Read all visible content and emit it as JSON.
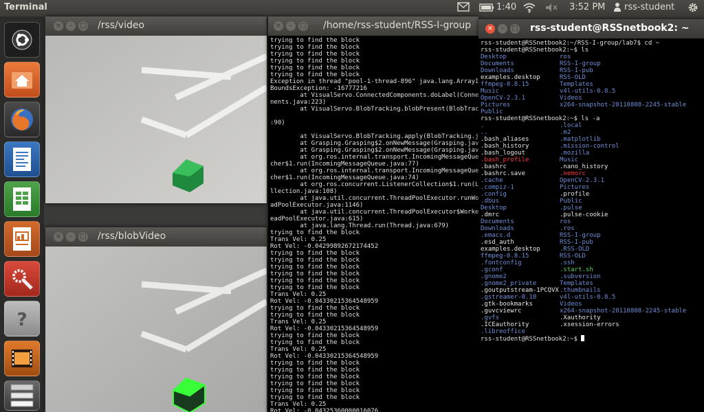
{
  "topbar": {
    "app_title": "Terminal",
    "clock_main": "1:40",
    "clock_time": "3:52 PM",
    "user": "rss-student"
  },
  "launcher": {
    "items": [
      {
        "name": "dash-home-icon"
      },
      {
        "name": "home-folder-icon"
      },
      {
        "name": "firefox-icon"
      },
      {
        "name": "writer-icon"
      },
      {
        "name": "calc-icon"
      },
      {
        "name": "impress-icon"
      },
      {
        "name": "system-settings-icon"
      },
      {
        "name": "help-icon"
      },
      {
        "name": "video-editor-icon"
      },
      {
        "name": "workspace-switcher-icon"
      }
    ]
  },
  "windows": {
    "video": {
      "title": "/rss/video"
    },
    "blob": {
      "title": "/rss/blobVideo"
    },
    "terminal_main": {
      "title": "/home/rss-student/RSS-I-group"
    },
    "terminal_right": {
      "title": "rss-student@RSSnetbook2: ~"
    }
  },
  "terminal_main_lines": [
    "trying to find the block",
    "trying to find the block",
    "trying to find the block",
    "trying to find the block",
    "trying to find the block",
    "trying to find the block",
    "Exception in thread \"pool-1-thread-896\" java.lang.ArrayIndex",
    "BoundsException: -16777216",
    "        at VisualServo.ConnectedComponents.doLabel(Connecte",
    "nents.java:223)",
    "        at VisualServo.BlobTracking.blobPresent(BlobTracking",
    "",
    ":90)",
    "",
    "        at VisualServo.BlobTracking.apply(BlobTracking.java",
    "        at Grasping.Grasping$2.onNewMessage(Grasping.java:31",
    "        at Grasping.Grasping$2.onNewMessage(Grasping.java:23",
    "        at org.ros.internal.transport.IncomingMessageQueue$1",
    "cher$1.run(IncomingMessageQueue.java:77)",
    "        at org.ros.internal.transport.IncomingMessageQueue$D",
    "cher$1.run(IncomingMessageQueue.java:74)",
    "        at org.ros.concurrent.ListenerCollection$1.run(Liste",
    "llection.java:108)",
    "        at java.util.concurrent.ThreadPoolExecutor.runWorker",
    "adPoolExecutor.java:1146)",
    "        at java.util.concurrent.ThreadPoolExecutor$Worker.ru",
    "eadPoolExecutor.java:615)",
    "        at java.lang.Thread.run(Thread.java:679)",
    "trying to find the block",
    "Trans Vel: 0.25",
    "Rot Vel: -0.04299892672174452",
    "trying to find the block",
    "trying to find the block",
    "trying to find the block",
    "trying to find the block",
    "trying to find the block",
    "trying to find the block",
    "Trans Vel: 0.25",
    "Rot Vel: -0.04330215364548959",
    "trying to find the block",
    "trying to find the block",
    "Trans Vel: 0.25",
    "Rot Vel: -0.04330215364548959",
    "trying to find the block",
    "trying to find the block",
    "Trans Vel: 0.25",
    "Rot Vel: -0.04330215364548959",
    "trying to find the block",
    "trying to find the block",
    "trying to find the block",
    "trying to find the block",
    "trying to find the block",
    "trying to find the block",
    "Trans Vel: 0.25",
    "Rot Vel: -0.04325360000016076"
  ],
  "terminal_right": {
    "cmd1_prompt": "rss-student@RSSnetbook2:~/RSS-I-group/lab7$ cd ~",
    "cmd2_prompt": "rss-student@RSSnetbook2:~$ ls",
    "ls_rows": [
      [
        {
          "t": "Desktop",
          "c": "blue"
        },
        {
          "t": "ros",
          "c": "blue"
        }
      ],
      [
        {
          "t": "Documents",
          "c": "blue"
        },
        {
          "t": "RSS-I-group",
          "c": "blue"
        }
      ],
      [
        {
          "t": "Downloads",
          "c": "blue"
        },
        {
          "t": "RSS-I-pub",
          "c": "blue"
        }
      ],
      [
        {
          "t": "examples.desktop",
          "c": "white"
        },
        {
          "t": "RSS-OLD",
          "c": "blue"
        }
      ],
      [
        {
          "t": "ffmpeg-0.8.15",
          "c": "blue"
        },
        {
          "t": "Templates",
          "c": "blue"
        }
      ],
      [
        {
          "t": "Music",
          "c": "blue"
        },
        {
          "t": "v4l-utils-0.8.5",
          "c": "blue"
        }
      ],
      [
        {
          "t": "OpenCV-2.3.1",
          "c": "blue"
        },
        {
          "t": "Videos",
          "c": "blue"
        }
      ],
      [
        {
          "t": "Pictures",
          "c": "blue"
        },
        {
          "t": "x264-snapshot-20110808-2245-stable",
          "c": "blue"
        }
      ],
      [
        {
          "t": "Public",
          "c": "blue"
        },
        {
          "t": "",
          "c": "white"
        }
      ]
    ],
    "cmd3_prompt": "rss-student@RSSnetbook2:~$ ls -a",
    "lsa_rows": [
      [
        {
          "t": ".",
          "c": "blue"
        },
        {
          "t": ".local",
          "c": "blue"
        }
      ],
      [
        {
          "t": "..",
          "c": "blue"
        },
        {
          "t": ".m2",
          "c": "blue"
        }
      ],
      [
        {
          "t": ".bash_aliases",
          "c": "white"
        },
        {
          "t": ".matplotlib",
          "c": "blue"
        }
      ],
      [
        {
          "t": ".bash_history",
          "c": "white"
        },
        {
          "t": ".mission-control",
          "c": "blue"
        }
      ],
      [
        {
          "t": ".bash_logout",
          "c": "white"
        },
        {
          "t": ".mozilla",
          "c": "blue"
        }
      ],
      [
        {
          "t": ".bash_profile",
          "c": "red"
        },
        {
          "t": "Music",
          "c": "blue"
        }
      ],
      [
        {
          "t": ".bashrc",
          "c": "white"
        },
        {
          "t": ".nano_history",
          "c": "white"
        }
      ],
      [
        {
          "t": ".bashrc.save",
          "c": "white"
        },
        {
          "t": ".nemorc",
          "c": "red"
        }
      ],
      [
        {
          "t": ".cache",
          "c": "blue"
        },
        {
          "t": "OpenCV-2.3.1",
          "c": "blue"
        }
      ],
      [
        {
          "t": ".compiz-1",
          "c": "blue"
        },
        {
          "t": "Pictures",
          "c": "blue"
        }
      ],
      [
        {
          "t": ".config",
          "c": "blue"
        },
        {
          "t": ".profile",
          "c": "white"
        }
      ],
      [
        {
          "t": ".dbus",
          "c": "blue"
        },
        {
          "t": "Public",
          "c": "blue"
        }
      ],
      [
        {
          "t": "Desktop",
          "c": "blue"
        },
        {
          "t": ".pulse",
          "c": "blue"
        }
      ],
      [
        {
          "t": ".dmrc",
          "c": "white"
        },
        {
          "t": ".pulse-cookie",
          "c": "white"
        }
      ],
      [
        {
          "t": "Documents",
          "c": "blue"
        },
        {
          "t": "ros",
          "c": "blue"
        }
      ],
      [
        {
          "t": "Downloads",
          "c": "blue"
        },
        {
          "t": ".ros",
          "c": "blue"
        }
      ],
      [
        {
          "t": ".emacs.d",
          "c": "blue"
        },
        {
          "t": "RSS-I-group",
          "c": "blue"
        }
      ],
      [
        {
          "t": ".esd_auth",
          "c": "white"
        },
        {
          "t": "RSS-I-pub",
          "c": "blue"
        }
      ],
      [
        {
          "t": "examples.desktop",
          "c": "white"
        },
        {
          "t": ".RSS-OLD",
          "c": "blue"
        }
      ],
      [
        {
          "t": "ffmpeg-0.8.15",
          "c": "blue"
        },
        {
          "t": "RSS-OLD",
          "c": "blue"
        }
      ],
      [
        {
          "t": ".fontconfig",
          "c": "blue"
        },
        {
          "t": ".ssh",
          "c": "blue"
        }
      ],
      [
        {
          "t": ".gconf",
          "c": "blue"
        },
        {
          "t": ".start.sh",
          "c": "green"
        }
      ],
      [
        {
          "t": ".gnome2",
          "c": "blue"
        },
        {
          "t": ".subversion",
          "c": "blue"
        }
      ],
      [
        {
          "t": ".gnome2_private",
          "c": "blue"
        },
        {
          "t": "Templates",
          "c": "blue"
        }
      ],
      [
        {
          "t": ".goutputstream-1PCQVX",
          "c": "white"
        },
        {
          "t": ".thumbnails",
          "c": "blue"
        }
      ],
      [
        {
          "t": ".gstreamer-0.10",
          "c": "blue"
        },
        {
          "t": "v4l-utils-0.8.5",
          "c": "blue"
        }
      ],
      [
        {
          "t": ".gtk-bookmarks",
          "c": "white"
        },
        {
          "t": "Videos",
          "c": "blue"
        }
      ],
      [
        {
          "t": ".guvcviewrc",
          "c": "white"
        },
        {
          "t": "x264-snapshot-20110808-2245-stable",
          "c": "blue"
        }
      ],
      [
        {
          "t": ".gvfs",
          "c": "blue"
        },
        {
          "t": ".Xauthority",
          "c": "white"
        }
      ],
      [
        {
          "t": ".ICEauthority",
          "c": "white"
        },
        {
          "t": ".xsession-errors",
          "c": "white"
        }
      ],
      [
        {
          "t": ".libreoffice",
          "c": "blue"
        },
        {
          "t": "",
          "c": "white"
        }
      ]
    ],
    "final_prompt": "rss-student@RSSnetbook2:~$ "
  }
}
